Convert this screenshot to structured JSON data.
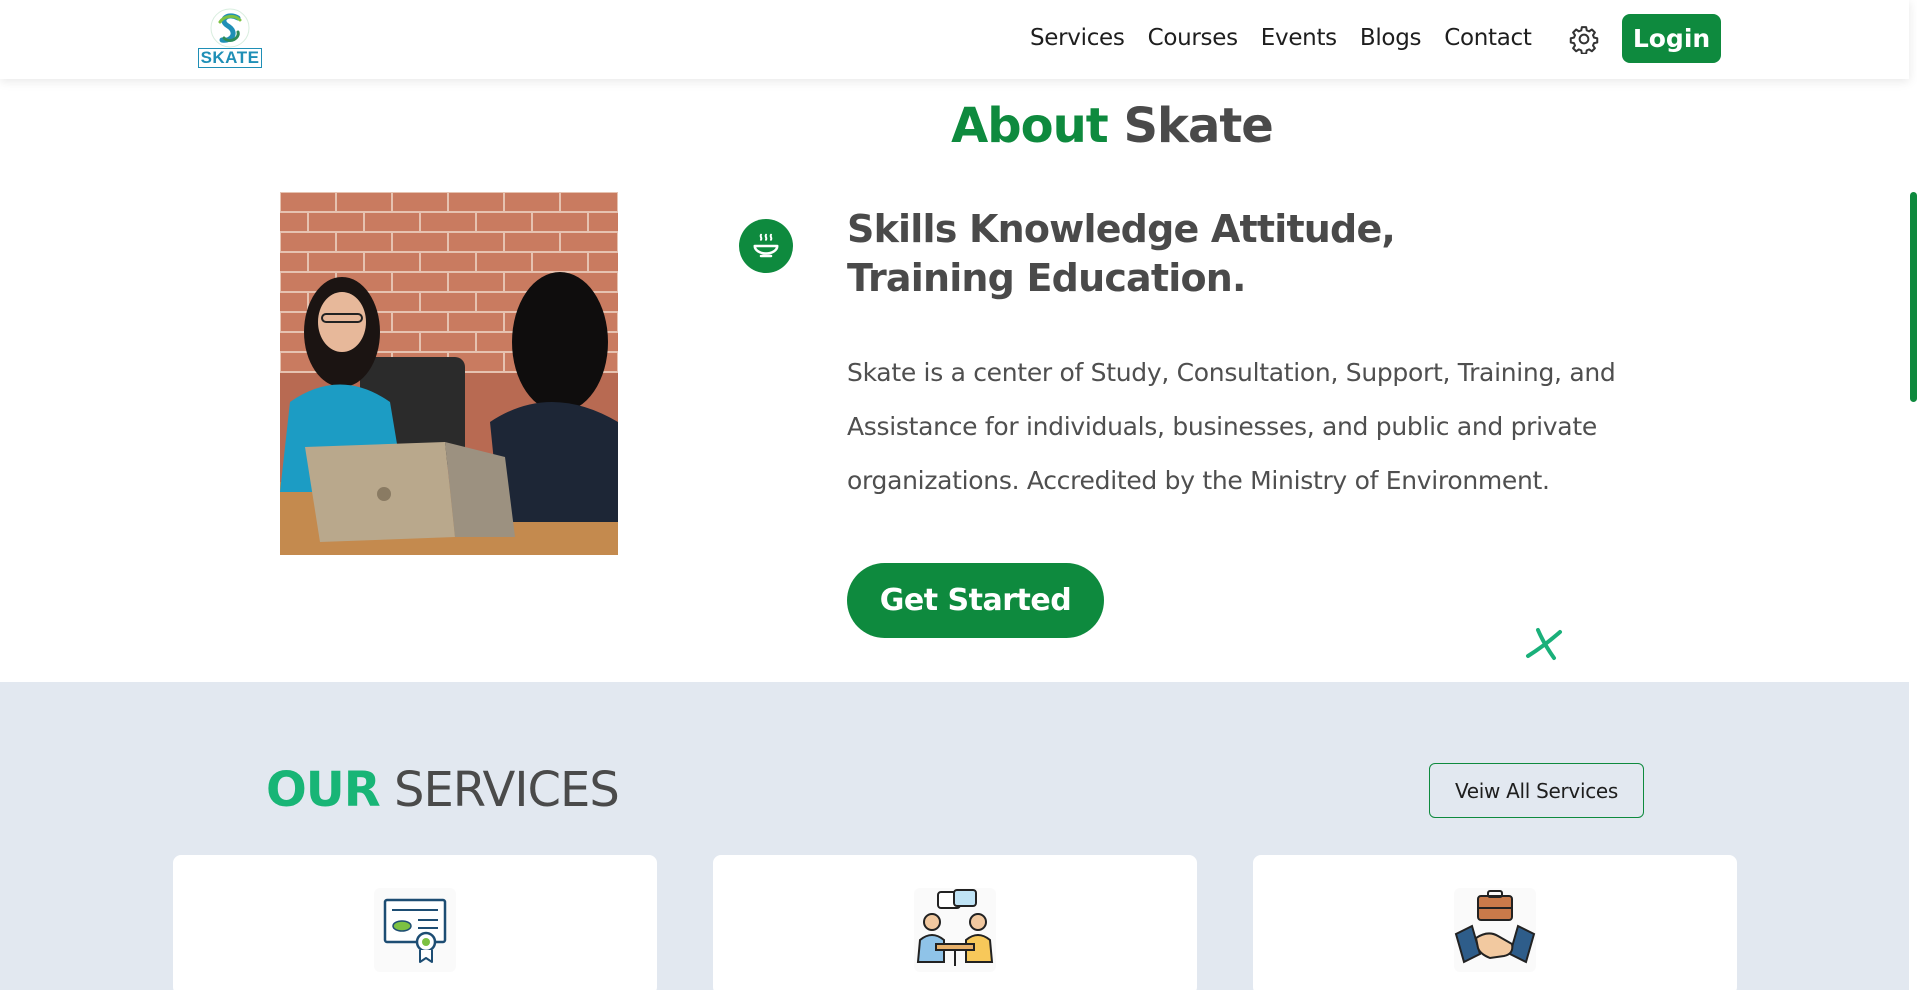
{
  "header": {
    "logo_text": "SKATE",
    "nav": [
      "Services",
      "Courses",
      "Events",
      "Blogs",
      "Contact"
    ],
    "login_label": "Login"
  },
  "about": {
    "title_highlight": "About",
    "title_rest": " Skate",
    "heading": "Skills Knowledge Attitude, Training Education.",
    "description": "Skate is a center of Study, Consultation, Support, Training, and Assistance for individuals, businesses, and public and private organizations. Accredited by the Ministry of Environment.",
    "cta_label": "Get Started"
  },
  "services": {
    "title_highlight": "OUR",
    "title_rest": " SERVICES",
    "view_all_label": "Veiw All Services",
    "cards": [
      {
        "icon": "certificate-icon"
      },
      {
        "icon": "consultation-icon"
      },
      {
        "icon": "handshake-briefcase-icon"
      }
    ]
  },
  "colors": {
    "brand_green": "#0e8a3e",
    "accent_teal": "#18b576",
    "section_bg": "#e2e8f0"
  }
}
